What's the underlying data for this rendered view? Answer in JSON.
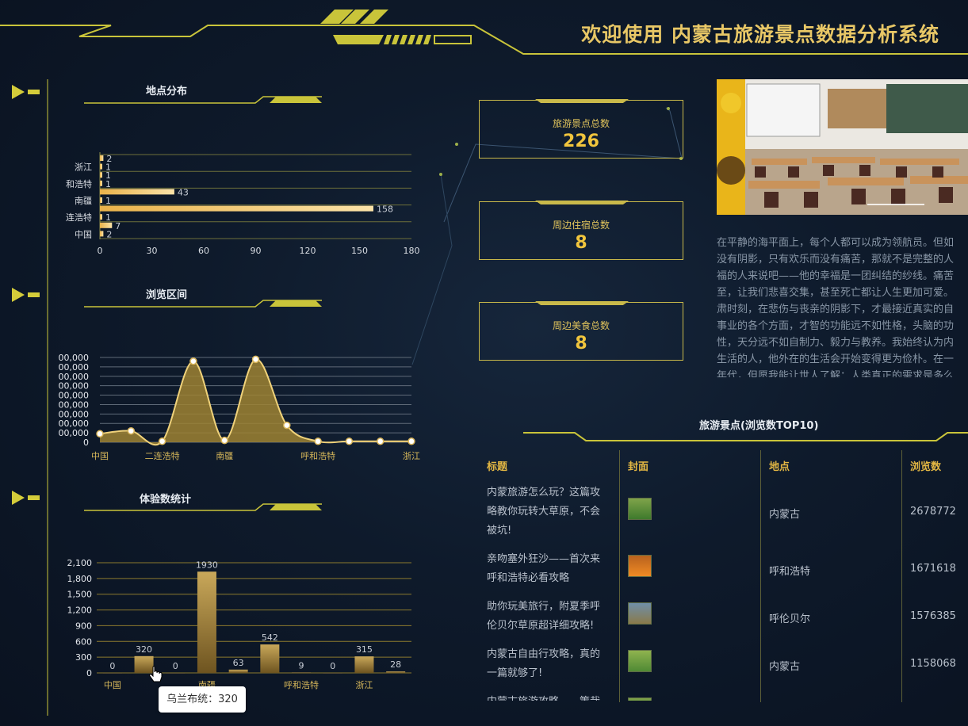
{
  "header": {
    "title": "欢迎使用 内蒙古旅游景点数据分析系统"
  },
  "sections": {
    "location": "地点分布",
    "views": "浏览区间",
    "experience": "体验数统计",
    "top10": "旅游景点(浏览数TOP10)"
  },
  "stats": [
    {
      "label": "旅游景点总数",
      "value": "226"
    },
    {
      "label": "周边住宿总数",
      "value": "8"
    },
    {
      "label": "周边美食总数",
      "value": "8"
    }
  ],
  "paragraph": [
    "在平静的海平面上，每个人都可以成为领航员。但如",
    "没有阴影，只有欢乐而没有痛苦，那就不是完整的人",
    "福的人来说吧——他的幸福是一团纠结的纱线。痛苦",
    "至，让我们悲喜交集，甚至死亡都让人生更加可爱。",
    "肃时刻，在悲伤与丧亲的阴影下，才最接近真实的自",
    "事业的各个方面，才智的功能远不如性格，头脑的功",
    "性，天分远不如自制力、毅力与教养。我始终认为内",
    "生活的人，他外在的生活会开始变得更为俭朴。在一",
    "年代，但愿我能让世人了解：人类真正的需求是多么"
  ],
  "table": {
    "headers": [
      "标题",
      "封面",
      "地点",
      "浏览数"
    ],
    "rows": [
      {
        "title": [
          "内蒙旅游怎么玩？这篇攻",
          "略教你玩转大草原，不会",
          "被坑!"
        ],
        "location": "内蒙古",
        "views": "2678772"
      },
      {
        "title": [
          "亲吻塞外狂沙——首次来",
          "呼和浩特必看攻略"
        ],
        "location": "呼和浩特",
        "views": "1671618"
      },
      {
        "title": [
          "助你玩美旅行，附夏季呼",
          "伦贝尔草原超详细攻略!"
        ],
        "location": "呼伦贝尔",
        "views": "1576385"
      },
      {
        "title": [
          "内蒙古自由行攻略，真的",
          "一篇就够了!"
        ],
        "location": "内蒙古",
        "views": "1158068"
      },
      {
        "title": [
          "内蒙古旅游攻略——策哉"
        ],
        "location": "",
        "views": ""
      }
    ]
  },
  "tooltip": {
    "text": "乌兰布统：320"
  },
  "colors": {
    "accent": "#e8c766",
    "gold": "#f1c53d",
    "olive": "#c9c43a"
  },
  "chart_data": [
    {
      "type": "bar",
      "orientation": "horizontal",
      "title": "地点分布",
      "categories": [
        "中国",
        "",
        "连浩特",
        "",
        "南疆",
        "",
        "和浩特",
        "",
        "浙江",
        ""
      ],
      "values": [
        2,
        7,
        1,
        158,
        1,
        43,
        1,
        1,
        1,
        2
      ],
      "xticks": [
        "0",
        "30",
        "60",
        "90",
        "120",
        "150",
        "180"
      ],
      "xlim": [
        0,
        180
      ]
    },
    {
      "type": "area",
      "title": "浏览区间",
      "categories": [
        "中国",
        "",
        "二连浩特",
        "",
        "南疆",
        "",
        "",
        "呼和浩特",
        "",
        "",
        "浙江"
      ],
      "xtick_labels": [
        "中国",
        "二连浩特",
        "南疆",
        "呼和浩特",
        "浙江"
      ],
      "values": [
        90000,
        120000,
        10000,
        860000,
        20000,
        880000,
        180000,
        10000,
        10000,
        10000,
        10000
      ],
      "yticks": [
        "0",
        "00,000",
        "00,000",
        "00,000",
        "00,000",
        "00,000",
        "00,000",
        "00,000",
        "00,000",
        "00,000"
      ]
    },
    {
      "type": "bar",
      "title": "体验数统计",
      "categories": [
        "中国",
        "",
        "",
        "南疆",
        "",
        "",
        "呼和浩特",
        "",
        "浙江",
        ""
      ],
      "xtick_labels": [
        "中国",
        "南疆",
        "呼和浩特",
        "浙江"
      ],
      "values": [
        0,
        320,
        0,
        1930,
        63,
        542,
        9,
        0,
        315,
        28
      ],
      "yticks": [
        "0",
        "300",
        "600",
        "900",
        "1,200",
        "1,500",
        "1,800",
        "2,100"
      ],
      "ylim": [
        0,
        2100
      ]
    }
  ]
}
